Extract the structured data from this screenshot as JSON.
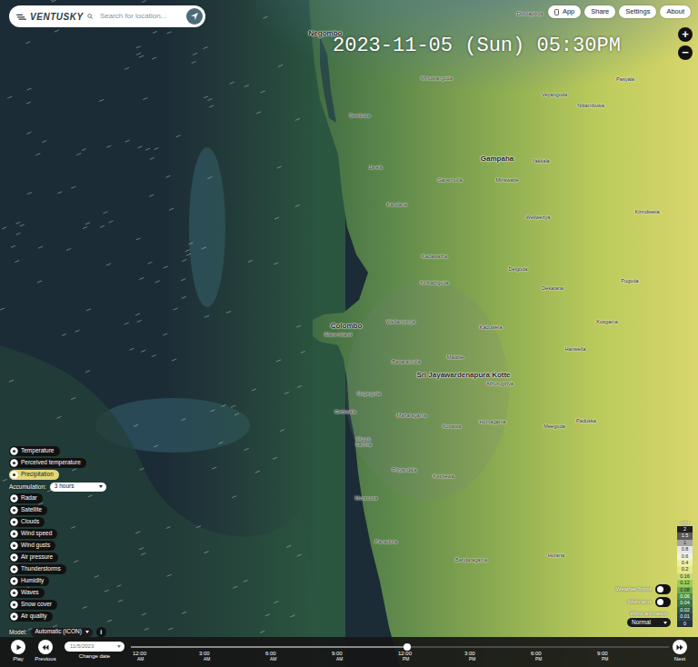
{
  "header": {
    "logo": "VENTUSKY",
    "search": {
      "placeholder": "Search for location..."
    },
    "menu": [
      {
        "label": "App"
      },
      {
        "label": "Share"
      },
      {
        "label": "Settings"
      },
      {
        "label": "About"
      }
    ]
  },
  "datetime": "2023-11-05 (Sun) 05:30PM",
  "zoom": {
    "in": "+",
    "out": "−"
  },
  "places": [
    {
      "name": "Divulapitiya",
      "kind": "town"
    },
    {
      "name": "Negombo",
      "kind": "city"
    },
    {
      "name": "Minuwangoda",
      "kind": "town"
    },
    {
      "name": "Seeduwa",
      "kind": "town"
    },
    {
      "name": "Veyangoda",
      "kind": "town"
    },
    {
      "name": "Nittambuwa",
      "kind": "town"
    },
    {
      "name": "Pasyala",
      "kind": "town"
    },
    {
      "name": "Ja-ela",
      "kind": "town"
    },
    {
      "name": "Ganemulla",
      "kind": "town"
    },
    {
      "name": "Gampaha",
      "kind": "city"
    },
    {
      "name": "Yakkala",
      "kind": "town"
    },
    {
      "name": "Miriswatte",
      "kind": "town"
    },
    {
      "name": "Kandana",
      "kind": "town"
    },
    {
      "name": "Weliweriya",
      "kind": "town"
    },
    {
      "name": "Kirindiwela",
      "kind": "town"
    },
    {
      "name": "Kadawatha",
      "kind": "town"
    },
    {
      "name": "Delgoda",
      "kind": "town"
    },
    {
      "name": "Pugoda",
      "kind": "town"
    },
    {
      "name": "Kiribathgoda",
      "kind": "town"
    },
    {
      "name": "Dekatana",
      "kind": "town"
    },
    {
      "name": "Colombo",
      "kind": "city"
    },
    {
      "name": "Slave Island",
      "kind": "town"
    },
    {
      "name": "Wellampitiya",
      "kind": "town"
    },
    {
      "name": "Kaduwela",
      "kind": "town"
    },
    {
      "name": "Kosgama",
      "kind": "town"
    },
    {
      "name": "Hanwella",
      "kind": "town"
    },
    {
      "name": "Malabe",
      "kind": "town"
    },
    {
      "name": "Battaramulla",
      "kind": "town"
    },
    {
      "name": "Sri Jayawardenapura Kotte",
      "kind": "city"
    },
    {
      "name": "Athurugiriya",
      "kind": "town"
    },
    {
      "name": "Nugegoda",
      "kind": "town"
    },
    {
      "name": "Dehiwala",
      "kind": "town"
    },
    {
      "name": "Maharagama",
      "kind": "town"
    },
    {
      "name": "Homagama",
      "kind": "town"
    },
    {
      "name": "Kottawa",
      "kind": "town"
    },
    {
      "name": "Padukka",
      "kind": "town"
    },
    {
      "name": "Meegoda",
      "kind": "town"
    },
    {
      "name": "Mount Lavinia",
      "kind": "town"
    },
    {
      "name": "Piliyandala",
      "kind": "town"
    },
    {
      "name": "Kesbewa",
      "kind": "town"
    },
    {
      "name": "Moratuwa",
      "kind": "town"
    },
    {
      "name": "Panadura",
      "kind": "town"
    },
    {
      "name": "Bandaragama",
      "kind": "town"
    },
    {
      "name": "Horana",
      "kind": "town"
    }
  ],
  "layers": [
    {
      "label": "Temperature",
      "selected": false
    },
    {
      "label": "Perceived temperature",
      "selected": false
    },
    {
      "label": "Precipitation",
      "selected": true
    },
    {
      "label": "Radar",
      "selected": false
    },
    {
      "label": "Satellite",
      "selected": false
    },
    {
      "label": "Clouds",
      "selected": false
    },
    {
      "label": "Wind speed",
      "selected": false
    },
    {
      "label": "Wind gusts",
      "selected": false
    },
    {
      "label": "Air pressure",
      "selected": false
    },
    {
      "label": "Thunderstorms",
      "selected": false
    },
    {
      "label": "Humidity",
      "selected": false
    },
    {
      "label": "Waves",
      "selected": false
    },
    {
      "label": "Snow cover",
      "selected": false
    },
    {
      "label": "Air quality",
      "selected": false
    }
  ],
  "accumulation": {
    "label": "Accumulation:",
    "value": "3 hours"
  },
  "model": {
    "label": "Model:",
    "value": "Automatic (ICON)",
    "info": "i"
  },
  "legend": {
    "unit": "mm",
    "items": [
      {
        "value": "2",
        "color": "#202020"
      },
      {
        "value": "1.5",
        "color": "#5a5a5a"
      },
      {
        "value": "1",
        "color": "#a5a5a5"
      },
      {
        "value": "0.8",
        "color": "#e8e8e8"
      },
      {
        "value": "0.6",
        "color": "#f4f4dc"
      },
      {
        "value": "0.4",
        "color": "#f0f0b0"
      },
      {
        "value": "0.2",
        "color": "#e6e68a"
      },
      {
        "value": "0.16",
        "color": "#c8dc78"
      },
      {
        "value": "0.12",
        "color": "#9ccc5a"
      },
      {
        "value": "0.08",
        "color": "#6fb04a"
      },
      {
        "value": "0.06",
        "color": "#4e9048"
      },
      {
        "value": "0.04",
        "color": "#3c7448"
      },
      {
        "value": "0.02",
        "color": "#30584a"
      },
      {
        "value": "0.01",
        "color": "#2a4550"
      },
      {
        "value": "0",
        "color": "#26333a"
      }
    ]
  },
  "options": [
    {
      "label": "Weather fronts",
      "kind": "toggle",
      "on": false
    },
    {
      "label": "Webcams",
      "kind": "toggle",
      "on": false
    },
    {
      "label": "Wind animation",
      "kind": "select",
      "value": "Normal"
    }
  ],
  "timeline": {
    "play": "Play",
    "previous": "Previous",
    "date_value": "11/5/2023",
    "change_date": "Change date",
    "next": "Next",
    "level": 0.52,
    "ticks": [
      {
        "time": "12:00",
        "ampm": "AM"
      },
      {
        "time": "3:00",
        "ampm": "AM"
      },
      {
        "time": "6:00",
        "ampm": "AM"
      },
      {
        "time": "9:00",
        "ampm": "AM"
      },
      {
        "time": "12:00",
        "ampm": "PM"
      },
      {
        "time": "3:00",
        "ampm": "PM"
      },
      {
        "time": "6:00",
        "ampm": "PM"
      },
      {
        "time": "9:00",
        "ampm": "PM"
      }
    ]
  }
}
